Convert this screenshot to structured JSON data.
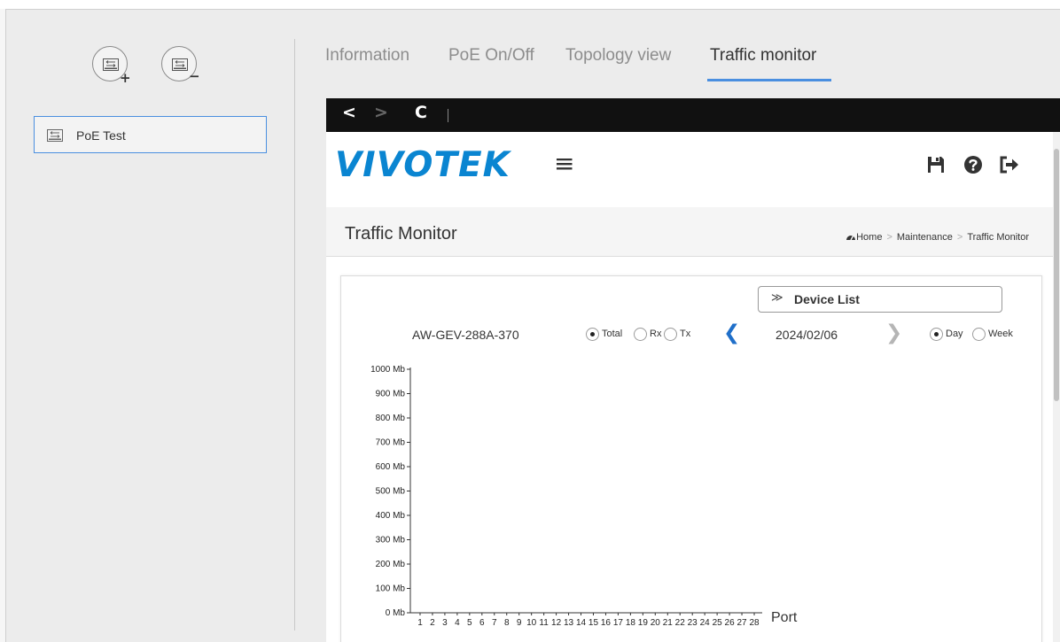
{
  "device_panel": {
    "items": [
      {
        "label": "PoE Test"
      }
    ]
  },
  "tabs": [
    {
      "label": "Information"
    },
    {
      "label": "PoE On/Off"
    },
    {
      "label": "Topology view"
    },
    {
      "label": "Traffic monitor"
    }
  ],
  "browser": {
    "back": "<",
    "forward": ">",
    "reload": "C"
  },
  "web": {
    "logo": "VIVOTEK",
    "menu_icon": "hamburger-icon",
    "header_icons": [
      "save-icon",
      "help-icon",
      "logout-icon"
    ],
    "page_title": "Traffic Monitor",
    "breadcrumb": [
      "Home",
      "Maintenance",
      "Traffic Monitor"
    ],
    "device_list_label": "Device List",
    "device_name": "AW-GEV-288A-370",
    "direction_options": [
      "Total",
      "Rx",
      "Tx"
    ],
    "date": "2024/02/06",
    "period_options": [
      "Day",
      "Week"
    ]
  },
  "colors": {
    "accent": "#4a8fe0",
    "logo": "#0a85d1",
    "nav_arrow_active": "#1f6fc9",
    "nav_arrow_disabled": "#b5b5b5"
  },
  "chart_data": {
    "type": "bar",
    "y_ticks": [
      "0 Mb",
      "100 Mb",
      "200 Mb",
      "300 Mb",
      "400 Mb",
      "500 Mb",
      "600 Mb",
      "700 Mb",
      "800 Mb",
      "900 Mb",
      "1000 Mb"
    ],
    "ylim": [
      0,
      1000
    ],
    "xlabel": "Port",
    "categories": [
      "1",
      "2",
      "3",
      "4",
      "5",
      "6",
      "7",
      "8",
      "9",
      "10",
      "11",
      "12",
      "13",
      "14",
      "15",
      "16",
      "17",
      "18",
      "19",
      "20",
      "21",
      "22",
      "23",
      "24",
      "25",
      "26",
      "27",
      "28"
    ],
    "values": [
      0,
      0,
      0,
      0,
      0,
      0,
      0,
      0,
      0,
      0,
      0,
      0,
      0,
      0,
      0,
      0,
      0,
      0,
      0,
      0,
      0,
      0,
      0,
      0,
      0,
      0,
      0,
      0
    ]
  }
}
